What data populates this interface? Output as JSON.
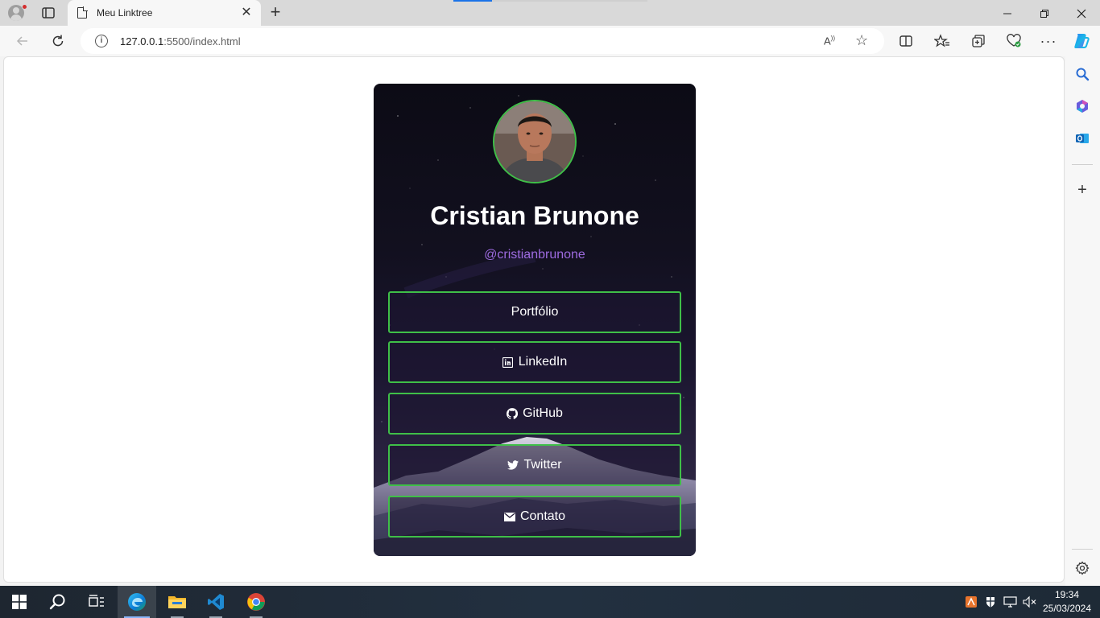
{
  "browser": {
    "tab_title": "Meu Linktree",
    "url_prefix": "127.0.0.1",
    "url_rest": ":5500/index.html"
  },
  "profile": {
    "name": "Cristian Brunone",
    "handle": "@cristianbrunone"
  },
  "links": [
    {
      "label": "Portfólio",
      "icon": "none"
    },
    {
      "label": "LinkedIn",
      "icon": "linkedin-icon"
    },
    {
      "label": "GitHub",
      "icon": "github-icon"
    },
    {
      "label": "Twitter",
      "icon": "twitter-icon"
    },
    {
      "label": "Contato",
      "icon": "mail-icon"
    }
  ],
  "colors": {
    "accent_border": "#3fbf48",
    "handle_purple": "#9e6be0",
    "card_bg": "#12101f"
  },
  "taskbar": {
    "time": "19:34",
    "date": "25/03/2024"
  }
}
